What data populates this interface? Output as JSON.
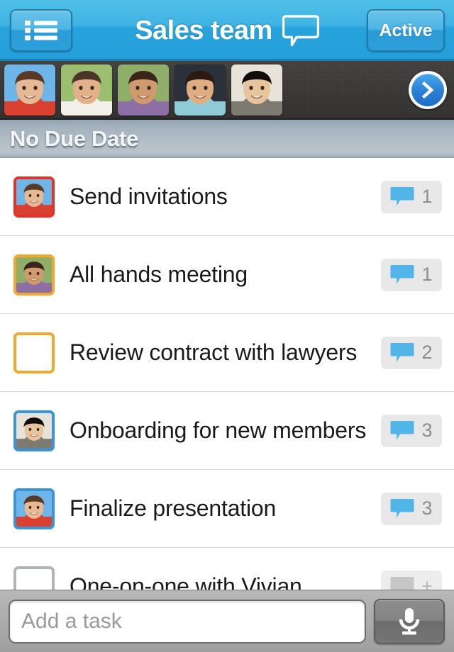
{
  "navbar": {
    "list_button_icon": "list-icon",
    "title": "Sales team",
    "title_icon": "chat-bubble-icon",
    "active_label": "Active",
    "background_color": "#2fa5db",
    "title_color": "#ffffff"
  },
  "avatar_strip": {
    "background_color": "#3a3836",
    "next_button_icon": "chevron-right-icon",
    "members": [
      {
        "name": "member-1",
        "skin": "#e6b894",
        "hair": "#5a3a26",
        "bg": "#6fb6e8",
        "shirt": "#d94030"
      },
      {
        "name": "member-2",
        "skin": "#e2b089",
        "hair": "#4a3526",
        "bg": "#9bbf6e",
        "shirt": "#f3f0ea"
      },
      {
        "name": "member-3",
        "skin": "#cf9a6e",
        "hair": "#3b2418",
        "bg": "#8fae6a",
        "shirt": "#8d6fa5"
      },
      {
        "name": "member-4",
        "skin": "#e0ad83",
        "hair": "#2a1a12",
        "bg": "#2b3138",
        "shirt": "#8ecbd6"
      },
      {
        "name": "member-5",
        "skin": "#e7c49c",
        "hair": "#120d0a",
        "bg": "#e8e3d8",
        "shirt": "#7d7a72"
      }
    ]
  },
  "section": {
    "title": "No Due Date",
    "background_color": "#b0bcc6"
  },
  "tasks": [
    {
      "title": "Send invitations",
      "marker_type": "avatar",
      "marker_border_color": "#e0342a",
      "avatar": {
        "skin": "#e6b894",
        "hair": "#5a3a26",
        "bg": "#6fb6e8",
        "shirt": "#d94030"
      },
      "comment_count": "1",
      "comment_state": "active"
    },
    {
      "title": "All hands meeting",
      "marker_type": "avatar",
      "marker_border_color": "#f0a830",
      "avatar": {
        "skin": "#cf9a6e",
        "hair": "#3b2418",
        "bg": "#8fae6a",
        "shirt": "#8d6fa5"
      },
      "comment_count": "1",
      "comment_state": "active"
    },
    {
      "title": "Review contract with lawyers",
      "marker_type": "checkbox",
      "marker_border_color": "#f0a830",
      "comment_count": "2",
      "comment_state": "active"
    },
    {
      "title": "Onboarding for new members",
      "marker_type": "avatar",
      "marker_border_color": "#3b93d9",
      "avatar": {
        "skin": "#e7c49c",
        "hair": "#120d0a",
        "bg": "#e8e3d8",
        "shirt": "#7d7a72"
      },
      "comment_count": "3",
      "comment_state": "active"
    },
    {
      "title": "Finalize presentation",
      "marker_type": "avatar",
      "marker_border_color": "#3b93d9",
      "avatar": {
        "skin": "#e6b894",
        "hair": "#5a3a26",
        "bg": "#6fb6e8",
        "shirt": "#d94030"
      },
      "comment_count": "3",
      "comment_state": "active"
    },
    {
      "title": "One-on-one with Vivian",
      "marker_type": "checkbox-gray",
      "marker_border_color": "#b0b4b7",
      "comment_count": "+",
      "comment_state": "muted"
    }
  ],
  "bottom_bar": {
    "input_value": "",
    "input_placeholder": "Add a task",
    "mic_icon": "microphone-icon",
    "background_color": "#a8a8a8"
  },
  "colors": {
    "accent_blue": "#2fa5db",
    "badge_blue": "#52b5e8",
    "overdue_red": "#e0342a",
    "warning_orange": "#f0a830"
  }
}
